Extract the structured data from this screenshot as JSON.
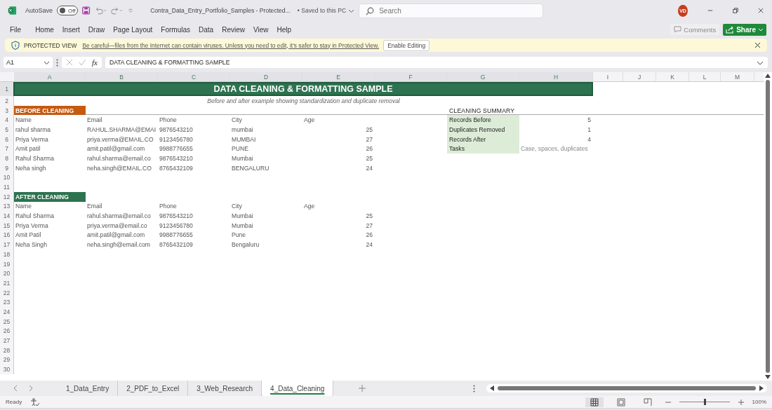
{
  "title_bar": {
    "autosave_label": "AutoSave",
    "autosave": {
      "on": false,
      "label": "Off"
    },
    "document_title": "Contra_Data_Entry_Portfolio_Samples  -  Protected...",
    "save_status": "•  Saved to this PC",
    "search_placeholder": "Search",
    "avatar": "VD"
  },
  "ribbon_tabs": [
    "File",
    "Home",
    "Insert",
    "Draw",
    "Page Layout",
    "Formulas",
    "Data",
    "Review",
    "View",
    "Help"
  ],
  "ribbon_actions": {
    "comments": "Comments",
    "share": "Share"
  },
  "protected_view": {
    "title": "PROTECTED VIEW",
    "message": "Be careful—files from the Internet can contain viruses. Unless you need to edit, it's safer to stay in Protected View.",
    "button": "Enable Editing"
  },
  "formula_bar": {
    "name_box": "A1",
    "fx": "fx",
    "formula": "DATA CLEANING & FORMATTING SAMPLE"
  },
  "columns": [
    "A",
    "B",
    "C",
    "D",
    "E",
    "F",
    "G",
    "H",
    "I",
    "J",
    "K",
    "L",
    "M"
  ],
  "row_numbers": [
    "1",
    "2",
    "3",
    "4",
    "5",
    "6",
    "7",
    "8",
    "9",
    "10",
    "11",
    "12",
    "13",
    "14",
    "15",
    "16",
    "17",
    "18",
    "19",
    "20",
    "21",
    "22",
    "23",
    "24",
    "25",
    "26",
    "27",
    "28",
    "29",
    "30"
  ],
  "sheet": {
    "title": "DATA CLEANING & FORMATTING SAMPLE",
    "subtitle": "Before and after example showing standardization and duplicate removal",
    "tables": [
      {
        "label": "BEFORE CLEANING",
        "color": "#c55a11",
        "headers": [
          "Name",
          "Email",
          "Phone",
          "City",
          "Age"
        ],
        "rows": [
          [
            "rahul sharma",
            "RAHUL.SHARMA@EMAI",
            "9876543210",
            "mumbai",
            "25"
          ],
          [
            "Priya  Verma",
            "priya.verma@EMAIL.CO",
            "9123456780",
            "MUMBAI",
            "27"
          ],
          [
            "Amit patil",
            "amit.patil@gmail.com",
            "9988776655",
            "PUNE",
            "26"
          ],
          [
            "Rahul Sharma",
            "rahul.sharma@email.co",
            "9876543210",
            "Mumbai",
            "25"
          ],
          [
            "Neha singh",
            "neha.singh@EMAIL.CO",
            "8765432109",
            "BENGALURU",
            "24"
          ]
        ]
      },
      {
        "label": "AFTER CLEANING",
        "color": "#2d7350",
        "headers": [
          "Name",
          "Email",
          "Phone",
          "City",
          "Age"
        ],
        "rows": [
          [
            "Rahul Sharma",
            "rahul.sharma@email.co",
            "9876543210",
            "Mumbai",
            "25"
          ],
          [
            "Priya Verma",
            "priya.verma@email.co",
            "9123456780",
            "Mumbai",
            "27"
          ],
          [
            "Amit Patil",
            "amit.patil@gmail.com",
            "9988776655",
            "Pune",
            "26"
          ],
          [
            "Neha Singh",
            "neha.singh@email.com",
            "8765432109",
            "Bengaluru",
            "24"
          ]
        ]
      }
    ],
    "summary": {
      "title": "CLEANING SUMMARY",
      "rows": [
        {
          "label": "Records Before",
          "value": "5",
          "kind": "number"
        },
        {
          "label": "Duplicates Removed",
          "value": "1",
          "kind": "number"
        },
        {
          "label": "Records After",
          "value": "4",
          "kind": "number"
        },
        {
          "label": "Tasks",
          "value": "Case, spaces, duplicates",
          "kind": "text"
        }
      ]
    }
  },
  "sheet_tabs": [
    {
      "label": "1_Data_Entry",
      "selected": false
    },
    {
      "label": "2_PDF_to_Excel",
      "selected": false
    },
    {
      "label": "3_Web_Research",
      "selected": false
    },
    {
      "label": "4_Data_Cleaning",
      "selected": true
    }
  ],
  "status_bar": {
    "status": "Ready",
    "zoom": "100%",
    "zoom_slider": {
      "level": 0.5
    }
  }
}
